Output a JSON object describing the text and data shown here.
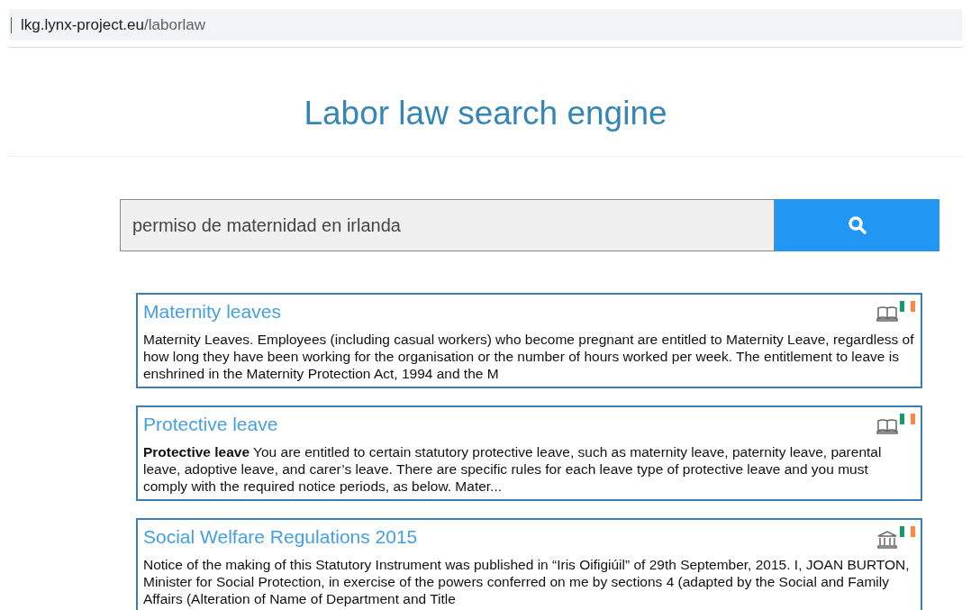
{
  "address_bar": {
    "host": "lkg.lynx-project.eu",
    "path": "/laborlaw"
  },
  "page_title": "Labor law search engine",
  "search": {
    "value": "permiso de maternidad en irlanda"
  },
  "results": [
    {
      "title": "Maternity leaves",
      "kind": "book",
      "snippet": "Maternity Leaves. Employees (including casual workers) who become pregnant are entitled to Maternity Leave, regardless of how long they have been working for the organisation or the number of hours worked per week. The entitlement to leave is enshrined in the Maternity Protection Act, 1994 and the M"
    },
    {
      "title": "Protective leave",
      "kind": "book",
      "snippet": "**Protective leave** You are entitled to certain statutory protective leave, such as maternity leave, paternity leave, parental leave, adoptive leave, and carer’s leave. There are specific rules for each leave type of protective leave and you must comply with the required notice periods, as below. Mater..."
    },
    {
      "title": "Social Welfare Regulations 2015",
      "kind": "legislation",
      "snippet": "Notice of the making of this Statutory Instrument was published in “Iris Oifigiúil” of 29th September, 2015. I, JOAN BURTON, Minister for Social Protection, in exercise of the powers conferred on me by sections 4 (adapted by the Social and Family Affairs (Alteration of Name of Department and Title"
    }
  ]
}
